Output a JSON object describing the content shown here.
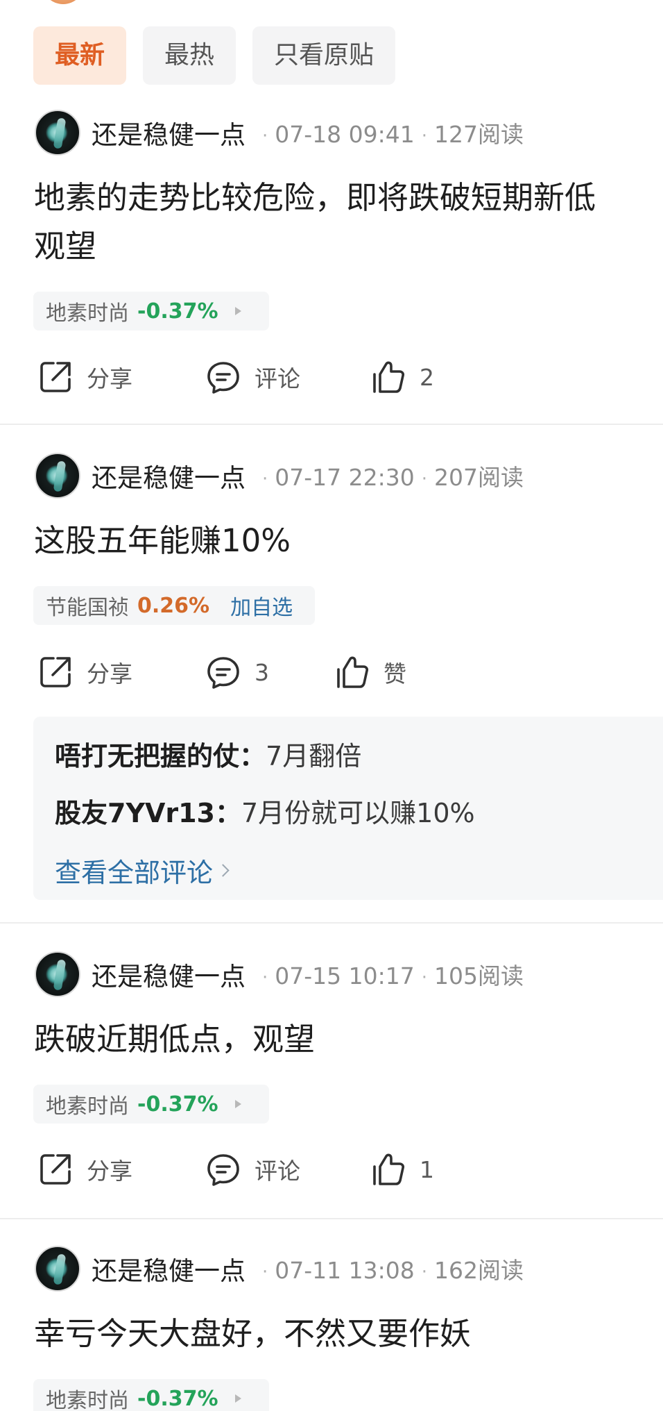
{
  "filter_tabs": [
    {
      "label": "最新"
    },
    {
      "label": "最热"
    },
    {
      "label": "只看原贴"
    }
  ],
  "posts": [
    {
      "author": "还是稳健一点",
      "datetime": "07-18 09:41",
      "reads": "127阅读",
      "body_line1": "地素的走势比较危险，即将跌破短期新低",
      "body_line2": "观望",
      "stock": {
        "name": "地素时尚",
        "change": "-0.37%"
      },
      "actions": {
        "share": "分享",
        "comment": "评论",
        "like": "2"
      }
    },
    {
      "author": "还是稳健一点",
      "datetime": "07-17 22:30",
      "reads": "207阅读",
      "body_line1": "这股五年能赚10%",
      "stock": {
        "name": "节能国祯",
        "change": "0.26%",
        "watch": "加自选"
      },
      "actions": {
        "share": "分享",
        "comment": "3",
        "like": "赞"
      },
      "comments": [
        {
          "author": "唔打无把握的仗：",
          "text": "7月翻倍"
        },
        {
          "author": "股友7YVr13：",
          "text": "7月份就可以赚10%"
        }
      ],
      "see_all": "查看全部评论"
    },
    {
      "author": "还是稳健一点",
      "datetime": "07-15 10:17",
      "reads": "105阅读",
      "body_line1": "跌破近期低点，观望",
      "stock": {
        "name": "地素时尚",
        "change": "-0.37%"
      },
      "actions": {
        "share": "分享",
        "comment": "评论",
        "like": "1"
      }
    },
    {
      "author": "还是稳健一点",
      "datetime": "07-11 13:08",
      "reads": "162阅读",
      "body_line1": "幸亏今天大盘好，不然又要作妖",
      "stock": {
        "name": "地素时尚",
        "change": "-0.37%"
      }
    }
  ],
  "colors": {
    "accent": "#df5e23",
    "active_tab_bg": "#fde9dc",
    "negative": "#24a35a",
    "positive": "#d36a2a",
    "link": "#2d6fa5"
  }
}
